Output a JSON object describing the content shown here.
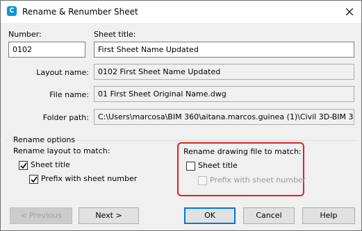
{
  "window": {
    "title": "Rename & Renumber Sheet",
    "app_icon_letter": "C",
    "app_icon_color": "#0696d7"
  },
  "form": {
    "number_label": "Number:",
    "number_value": "0102",
    "sheet_title_label": "Sheet title:",
    "sheet_title_value": "First Sheet Name Updated",
    "layout_name_label": "Layout name:",
    "layout_name_value": "0102 First Sheet Name Updated",
    "file_name_label": "File name:",
    "file_name_value": "01 First Sheet Original Name.dwg",
    "folder_path_label": "Folder path:",
    "folder_path_value": "C:\\Users\\marcosa\\BIM 360\\aitana.marcos.guinea (1)\\Civil 3D-BIM 360 suppo"
  },
  "rename_options": {
    "group_label": "Rename options",
    "layout_heading": "Rename layout to match:",
    "layout_sheet_title": {
      "label": "Sheet title",
      "checked": true,
      "enabled": true
    },
    "layout_prefix": {
      "label": "Prefix with sheet number",
      "checked": true,
      "enabled": true
    },
    "drawing_heading": "Rename drawing file to match:",
    "drawing_sheet_title": {
      "label": "Sheet title",
      "checked": false,
      "enabled": true
    },
    "drawing_prefix": {
      "label": "Prefix with sheet number",
      "checked": false,
      "enabled": false
    }
  },
  "buttons": {
    "previous": "< Previous",
    "next": "Next >",
    "ok": "OK",
    "cancel": "Cancel",
    "help": "Help"
  },
  "colors": {
    "highlight": "#e21f26",
    "default_button_border": "#0078d7"
  }
}
